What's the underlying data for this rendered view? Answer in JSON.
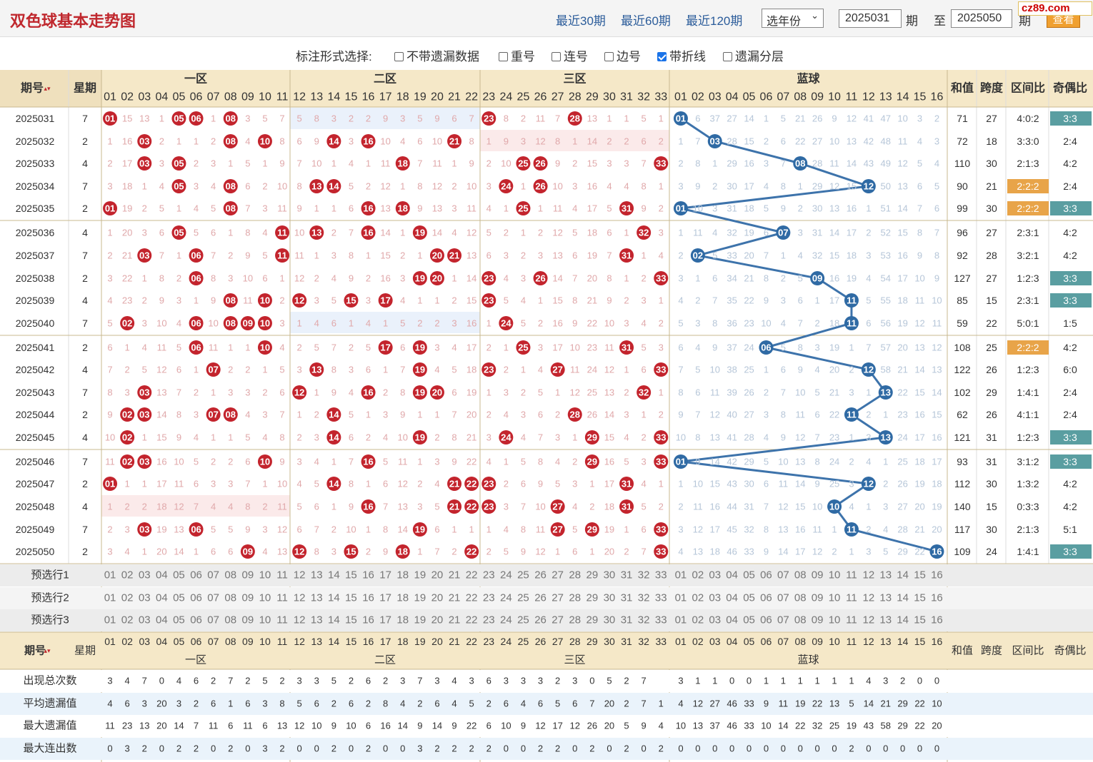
{
  "header": {
    "title": "双色球基本走势图",
    "links": [
      "最近30期",
      "最近60期",
      "最近120期"
    ],
    "year_select": "选年份",
    "from_period": "2025031",
    "period_label": "期",
    "to_label": "至",
    "to_period": "2025050",
    "to_suffix": "期",
    "query_button": "查看",
    "site_logo": "cz89.com"
  },
  "options": {
    "label": "标注形式选择:",
    "items": [
      {
        "label": "不带遗漏数据",
        "checked": false
      },
      {
        "label": "重号",
        "checked": false
      },
      {
        "label": "连号",
        "checked": false
      },
      {
        "label": "边号",
        "checked": false
      },
      {
        "label": "带折线",
        "checked": true
      },
      {
        "label": "遗漏分层",
        "checked": false
      }
    ]
  },
  "table_header": {
    "period": "期号",
    "weekday": "星期",
    "zones": [
      "一区",
      "二区",
      "三区",
      "蓝球"
    ],
    "stats": [
      "和值",
      "跨度",
      "区间比",
      "奇偶比"
    ]
  },
  "rows": [
    {
      "p": "2025031",
      "w": "7",
      "red": [
        1,
        5,
        6,
        8,
        23,
        28
      ],
      "blue": 1,
      "sum": "71",
      "span": "27",
      "zone": "4:0:2",
      "oe": "3:3",
      "zh": false,
      "oh": true,
      "rm": "01 15 13 1 05 06 1 08 3 5 7 5 8 3 2 2 9 3 5 9 6 7 23 8 2 11 7 28 13 1 1 5 1",
      "bm": "01 6 37 27 14 1 5 21 26 9 12 41 47 10 3 2"
    },
    {
      "p": "2025032",
      "w": "2",
      "red": [
        3,
        8,
        10,
        14,
        16,
        21
      ],
      "blue": 3,
      "sum": "72",
      "span": "18",
      "zone": "3:3:0",
      "oe": "2:4",
      "zh": false,
      "oh": false,
      "rm": "1 16 03 2 1 1 2 08 4 10 8 6 9 14 3 16 10 4 6 10 21 8 1 9 3 12 8 1 14 2 2 6 2",
      "bm": "1 7 03 28 15 2 6 22 27 10 13 42 48 11 4 3"
    },
    {
      "p": "2025033",
      "w": "4",
      "red": [
        3,
        5,
        18,
        25,
        26,
        33
      ],
      "blue": 8,
      "sum": "110",
      "span": "30",
      "zone": "2:1:3",
      "oe": "4:2",
      "zh": false,
      "oh": false,
      "rm": "2 17 03 3 05 2 3 1 5 1 9 7 10 1 4 1 11 18 7 11 1 9 2 10 25 26 9 2 15 3 3 7 33",
      "bm": "2 8 1 29 16 3 7 08 28 11 14 43 49 12 5 4"
    },
    {
      "p": "2025034",
      "w": "7",
      "red": [
        5,
        8,
        13,
        14,
        24,
        26
      ],
      "blue": 12,
      "sum": "90",
      "span": "21",
      "zone": "2:2:2",
      "oe": "2:4",
      "zh": true,
      "oh": false,
      "rm": "3 18 1 4 05 3 4 08 6 2 10 8 13 14 5 2 12 1 8 12 2 10 3 24 1 26 10 3 16 4 4 8 1",
      "bm": "3 9 2 30 17 4 8 1 29 12 15 12 50 13 6 5"
    },
    {
      "p": "2025035",
      "w": "2",
      "red": [
        1,
        8,
        16,
        18,
        25,
        31
      ],
      "blue": 1,
      "sum": "99",
      "span": "30",
      "zone": "2:2:2",
      "oe": "3:3",
      "zh": true,
      "oh": true,
      "rm": "01 19 2 5 1 4 5 08 7 3 11 9 1 1 6 16 13 18 9 13 3 11 4 1 25 1 11 4 17 5 31 9 2",
      "bm": "01 10 3 31 18 5 9 2 30 13 16 1 51 14 7 6"
    },
    {
      "p": "2025036",
      "w": "4",
      "red": [
        5,
        11,
        13,
        16,
        19,
        32
      ],
      "blue": 7,
      "sum": "96",
      "span": "27",
      "zone": "2:3:1",
      "oe": "4:2",
      "zh": false,
      "oh": false,
      "rm": "1 20 3 6 05 5 6 1 8 4 11 10 13 2 7 16 14 1 19 14 4 12 5 2 1 2 12 5 18 6 1 32 3",
      "bm": "1 11 4 32 19 6 07 3 31 14 17 2 52 15 8 7"
    },
    {
      "p": "2025037",
      "w": "7",
      "red": [
        3,
        6,
        11,
        20,
        21,
        31
      ],
      "blue": 2,
      "sum": "92",
      "span": "28",
      "zone": "3:2:1",
      "oe": "4:2",
      "zh": false,
      "oh": false,
      "rm": "2 21 03 7 1 06 7 2 9 5 11 11 1 3 8 1 15 2 1 20 21 13 6 3 2 3 13 6 19 7 31 1 4",
      "bm": "2 02 5 33 20 7 1 4 32 15 18 3 53 16 9 8"
    },
    {
      "p": "2025038",
      "w": "2",
      "red": [
        6,
        19,
        20,
        23,
        26,
        33
      ],
      "blue": 9,
      "sum": "127",
      "span": "27",
      "zone": "1:2:3",
      "oe": "3:3",
      "zh": false,
      "oh": true,
      "rm": "3 22 1 8 2 06 8 3 10 6 1 12 2 4 9 2 16 3 19 20 1 14 23 4 3 26 14 7 20 8 1 2 33",
      "bm": "3 1 6 34 21 8 2 5 09 16 19 4 54 17 10 9"
    },
    {
      "p": "2025039",
      "w": "4",
      "red": [
        8,
        10,
        12,
        15,
        17,
        23
      ],
      "blue": 11,
      "sum": "85",
      "span": "15",
      "zone": "2:3:1",
      "oe": "3:3",
      "zh": false,
      "oh": true,
      "rm": "4 23 2 9 3 1 9 08 11 10 2 12 3 5 15 3 17 4 1 1 2 15 23 5 4 1 15 8 21 9 2 3 1",
      "bm": "4 2 7 35 22 9 3 6 1 17 11 5 55 18 11 10"
    },
    {
      "p": "2025040",
      "w": "7",
      "red": [
        2,
        6,
        8,
        9,
        10,
        24
      ],
      "blue": 11,
      "sum": "59",
      "span": "22",
      "zone": "5:0:1",
      "oe": "1:5",
      "zh": false,
      "oh": false,
      "rm": "5 02 3 10 4 06 10 08 09 10 3 1 4 6 1 4 1 5 2 2 3 16 1 24 5 2 16 9 22 10 3 4 2",
      "bm": "5 3 8 36 23 10 4 7 2 18 11 6 56 19 12 11"
    },
    {
      "p": "2025041",
      "w": "2",
      "red": [
        6,
        10,
        17,
        19,
        25,
        31
      ],
      "blue": 6,
      "sum": "108",
      "span": "25",
      "zone": "2:2:2",
      "oe": "4:2",
      "zh": true,
      "oh": false,
      "rm": "6 1 4 11 5 06 11 1 1 10 4 2 5 7 2 5 17 6 19 3 4 17 2 1 25 3 17 10 23 11 31 5 3",
      "bm": "6 4 9 37 24 06 5 8 3 19 1 7 57 20 13 12"
    },
    {
      "p": "2025042",
      "w": "4",
      "red": [
        7,
        13,
        19,
        23,
        27,
        33
      ],
      "blue": 12,
      "sum": "122",
      "span": "26",
      "zone": "1:2:3",
      "oe": "6:0",
      "zh": false,
      "oh": false,
      "rm": "7 2 5 12 6 1 07 2 2 1 5 3 13 8 3 6 1 7 19 4 5 18 23 2 1 4 27 11 24 12 1 6 33",
      "bm": "7 5 10 38 25 1 6 9 4 20 2 12 58 21 14 13"
    },
    {
      "p": "2025043",
      "w": "7",
      "red": [
        3,
        12,
        16,
        19,
        20,
        32
      ],
      "blue": 13,
      "sum": "102",
      "span": "29",
      "zone": "1:4:1",
      "oe": "2:4",
      "zh": false,
      "oh": false,
      "rm": "8 3 03 13 7 2 1 3 3 2 6 12 1 9 4 16 2 8 19 20 6 19 1 3 2 5 1 12 25 13 2 32 1",
      "bm": "8 6 11 39 26 2 7 10 5 21 3 1 13 22 15 14"
    },
    {
      "p": "2025044",
      "w": "2",
      "red": [
        2,
        3,
        7,
        8,
        14,
        28
      ],
      "blue": 11,
      "sum": "62",
      "span": "26",
      "zone": "4:1:1",
      "oe": "2:4",
      "zh": false,
      "oh": false,
      "rm": "9 02 03 14 8 3 07 08 4 3 7 1 2 14 5 1 3 9 1 1 7 20 2 4 3 6 2 28 26 14 3 1 2",
      "bm": "9 7 12 40 27 3 8 11 6 22 11 2 1 23 16 15"
    },
    {
      "p": "2025045",
      "w": "4",
      "red": [
        2,
        14,
        19,
        24,
        29,
        33
      ],
      "blue": 13,
      "sum": "121",
      "span": "31",
      "zone": "1:2:3",
      "oe": "3:3",
      "zh": false,
      "oh": true,
      "rm": "10 02 1 15 9 4 1 1 5 4 8 2 3 14 6 2 4 10 19 2 8 21 3 24 4 7 3 1 29 15 4 2 33",
      "bm": "10 8 13 41 28 4 9 12 7 23 1 3 13 24 17 16"
    },
    {
      "p": "2025046",
      "w": "7",
      "red": [
        2,
        3,
        10,
        16,
        29,
        33
      ],
      "blue": 1,
      "sum": "93",
      "span": "31",
      "zone": "3:1:2",
      "oe": "3:3",
      "zh": false,
      "oh": true,
      "rm": "11 02 03 16 10 5 2 2 6 10 9 3 4 1 7 16 5 11 1 3 9 22 4 1 5 8 4 2 29 16 5 3 33",
      "bm": "01 9 14 42 29 5 10 13 8 24 2 4 1 25 18 17"
    },
    {
      "p": "2025047",
      "w": "2",
      "red": [
        1,
        14,
        21,
        22,
        23,
        31
      ],
      "blue": 12,
      "sum": "112",
      "span": "30",
      "zone": "1:3:2",
      "oe": "4:2",
      "zh": false,
      "oh": false,
      "rm": "01 1 1 17 11 6 3 3 7 1 10 4 5 14 8 1 6 12 2 4 21 22 23 2 6 9 5 3 1 17 31 4 1",
      "bm": "1 10 15 43 30 6 11 14 9 25 3 12 2 26 19 18"
    },
    {
      "p": "2025048",
      "w": "4",
      "red": [
        16,
        21,
        22,
        23,
        27,
        31
      ],
      "blue": 10,
      "sum": "140",
      "span": "15",
      "zone": "0:3:3",
      "oe": "4:2",
      "zh": false,
      "oh": false,
      "rm": "1 2 2 18 12 7 4 4 8 2 11 5 6 1 9 16 7 13 3 5 21 22 23 3 7 10 27 4 2 18 31 5 2",
      "bm": "2 11 16 44 31 7 12 15 10 10 4 1 3 27 20 19"
    },
    {
      "p": "2025049",
      "w": "7",
      "red": [
        3,
        6,
        19,
        27,
        29,
        33
      ],
      "blue": 11,
      "sum": "117",
      "span": "30",
      "zone": "2:1:3",
      "oe": "5:1",
      "zh": false,
      "oh": false,
      "rm": "2 3 03 19 13 06 5 5 9 3 12 6 7 2 10 1 8 14 19 6 1 1 1 4 8 11 27 5 29 19 1 6 33",
      "bm": "3 12 17 45 32 8 13 16 11 1 11 2 4 28 21 20"
    },
    {
      "p": "2025050",
      "w": "2",
      "red": [
        9,
        12,
        15,
        18,
        22,
        33
      ],
      "blue": 16,
      "sum": "109",
      "span": "24",
      "zone": "1:4:1",
      "oe": "3:3",
      "zh": false,
      "oh": true,
      "rm": "3 4 1 20 14 1 6 6 09 4 13 12 8 3 15 2 9 18 1 7 2 22 2 5 9 12 1 6 1 20 2 7 33",
      "bm": "4 13 18 46 33 9 14 17 12 2 1 3 5 29 22 16"
    }
  ],
  "preselect_rows": [
    "预选行1",
    "预选行2",
    "预选行3"
  ],
  "footer_header": {
    "period": "期号",
    "weekday": "星期",
    "zones": [
      "一区",
      "二区",
      "三区",
      "蓝球"
    ],
    "stats": [
      "和值",
      "跨度",
      "区间比",
      "奇偶比"
    ]
  },
  "summary_rows": [
    {
      "label": "出现总次数",
      "red": "3 4 7 0 4 6 2 7 2 5 2 3 3 5 2 6 2 3 7 3 4 3 6 3 3 3 2 3 0 5 2 7",
      "blue": "3 1 1 0 0 1 1 1 1 1 1 4 3 2 0 0 1"
    },
    {
      "label": "平均遗漏值",
      "red": "4 6 3 20 3 2 6 1 6 3 8 5 6 2 6 2 8 4 2 6 4 5 2 6 4 6 5 6 7 20 2 7 1",
      "blue": "4 12 27 46 33 9 11 19 22 13 5 14 21 29 22 10"
    },
    {
      "label": "最大遗漏值",
      "red": "11 23 13 20 14 7 11 6 11 6 13 12 10 9 10 6 16 14 9 14 9 22 6 10 9 12 17 12 26 20 5 9 4",
      "blue": "10 13 37 46 33 10 14 22 32 25 19 43 58 29 22 20"
    },
    {
      "label": "最大连出数",
      "red": "0 3 2 0 2 2 0 2 0 3 2 0 0 2 0 2 0 0 3 2 2 2 2 0 0 2 2 0 2 0 2 0 2",
      "blue": "0 0 0 0 0 0 0 0 0 0 2 0 0 0 0 0"
    }
  ],
  "colors": {
    "red_ball": "#c3242d",
    "blue_ball": "#2f6aa4",
    "zone_highlight": "#e8a449",
    "oddeven_highlight": "#5a9ea1",
    "header_bg": "#f5e8c8",
    "trend_line": "#3d73ab"
  }
}
